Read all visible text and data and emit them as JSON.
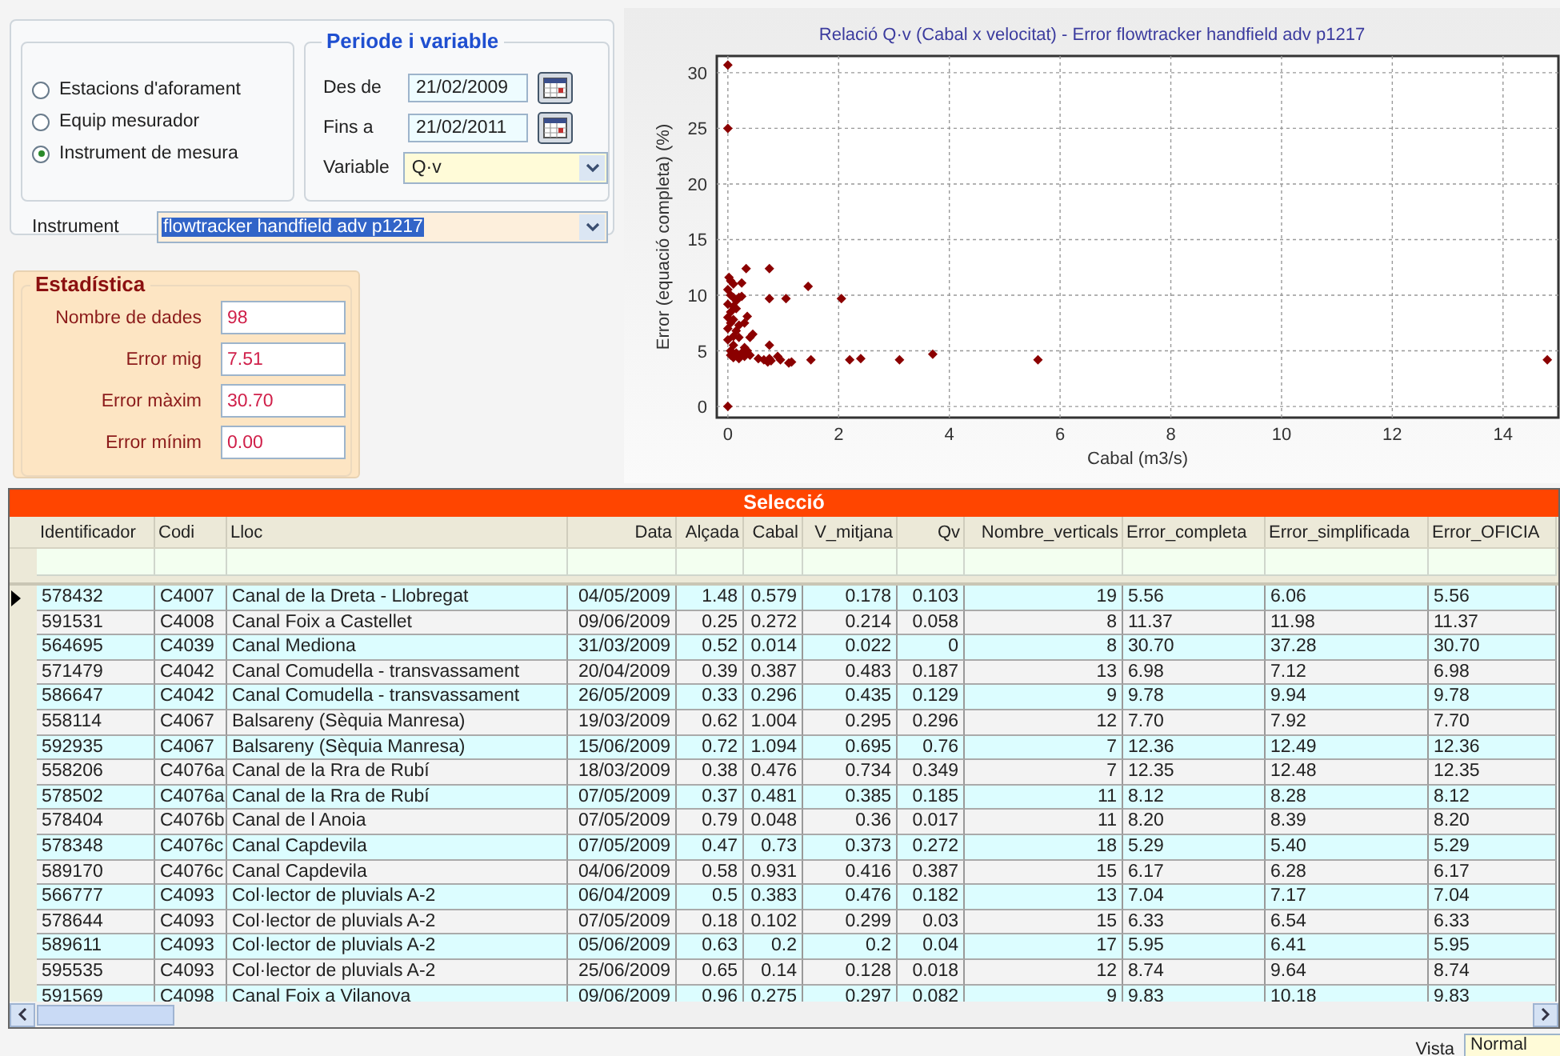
{
  "mode_options": [
    {
      "label": "Estacions d'aforament",
      "selected": false
    },
    {
      "label": "Equip mesurador",
      "selected": false
    },
    {
      "label": "Instrument de mesura",
      "selected": true
    }
  ],
  "period": {
    "title": "Periode i variable",
    "from_label": "Des de",
    "from_value": "21/02/2009",
    "to_label": "Fins a",
    "to_value": "21/02/2011",
    "variable_label": "Variable",
    "variable_value": "Q·v"
  },
  "instrument": {
    "label": "Instrument",
    "value": "flowtracker handfield adv p1217"
  },
  "statistics": {
    "title": "Estadística",
    "items": [
      {
        "label": "Nombre de dades",
        "value": "98"
      },
      {
        "label": "Error mig",
        "value": "7.51"
      },
      {
        "label": "Error màxim",
        "value": "30.70"
      },
      {
        "label": "Error mínim",
        "value": "0.00"
      }
    ]
  },
  "chart": {
    "chart_data": {
      "type": "scatter",
      "title": "Relació Q·v (Cabal x velocitat) - Error flowtracker handfield adv p1217",
      "xlabel": "Cabal (m3/s)",
      "ylabel": "Error (equació completa) (%)",
      "xlim": [
        -0.2,
        15
      ],
      "ylim": [
        -1,
        31.5
      ],
      "grid": true,
      "xticks": [
        0,
        2,
        4,
        6,
        8,
        10,
        12,
        14
      ],
      "yticks": [
        0,
        5,
        10,
        15,
        20,
        25,
        30
      ],
      "x": [
        0,
        0,
        0,
        0.02,
        0.05,
        0.1,
        0,
        0.05,
        0.1,
        0.2,
        0.25,
        0.15,
        0,
        0.1,
        0.05,
        0.15,
        0,
        0.1,
        0.35,
        0.05,
        0.2,
        0.3,
        0,
        0.15,
        0.1,
        0.2,
        0.45,
        0.4,
        0,
        0.1,
        0.3,
        0.35,
        0.05,
        0.15,
        0.25,
        0.05,
        0.1,
        0.2,
        0.3,
        0.4,
        0.55,
        0.65,
        0.72,
        0.75,
        0.78,
        0.9,
        0.95,
        1.1,
        1.15,
        1.5,
        2.2,
        2.4,
        3.1,
        3.7,
        5.6,
        14.8,
        0.75,
        0.33,
        0.75,
        1.45,
        0.75,
        1.05,
        2.05,
        0.25
      ],
      "series": [
        {
          "color": "#8b0000",
          "values": [
            30.7,
            25,
            0,
            11.6,
            11.3,
            11,
            10.5,
            10,
            9.8,
            9.8,
            9.9,
            9.5,
            9.2,
            9,
            8.5,
            8.8,
            8,
            7.8,
            8.1,
            7.5,
            7.3,
            7.5,
            7,
            6.8,
            6.3,
            6.2,
            6.5,
            6.2,
            6,
            5.5,
            5.3,
            5,
            5,
            4.8,
            4.8,
            4.6,
            4.4,
            4.3,
            4.5,
            4.6,
            4.3,
            4.2,
            4,
            4.3,
            4.1,
            4.5,
            4.2,
            3.9,
            4,
            4.2,
            4.2,
            4.3,
            4.2,
            4.7,
            4.2,
            4.2,
            5.5,
            12.4,
            12.4,
            10.8,
            9.7,
            9.7,
            9.7,
            11.1
          ]
        }
      ]
    }
  },
  "table": {
    "title": "Selecció",
    "columns": [
      "Identificador",
      "Codi",
      "Lloc",
      "Data",
      "Alçada",
      "Cabal",
      "V_mitjana",
      "Qv",
      "Nombre_verticals",
      "Error_completa",
      "Error_simplificada",
      "Error_OFICIA"
    ],
    "rows": [
      {
        "selected": true,
        "cells": [
          "578432",
          "C4007",
          "Canal de la Dreta - Llobregat",
          "04/05/2009",
          "1.48",
          "0.579",
          "0.178",
          "0.103",
          "19",
          "5.56",
          "6.06",
          "5.56"
        ]
      },
      {
        "selected": false,
        "cells": [
          "591531",
          "C4008",
          "Canal Foix a Castellet",
          "09/06/2009",
          "0.25",
          "0.272",
          "0.214",
          "0.058",
          "8",
          "11.37",
          "11.98",
          "11.37"
        ]
      },
      {
        "selected": false,
        "cells": [
          "564695",
          "C4039",
          "Canal Mediona",
          "31/03/2009",
          "0.52",
          "0.014",
          "0.022",
          "0",
          "8",
          "30.70",
          "37.28",
          "30.70"
        ]
      },
      {
        "selected": false,
        "cells": [
          "571479",
          "C4042",
          "Canal Comudella - transvassament",
          "20/04/2009",
          "0.39",
          "0.387",
          "0.483",
          "0.187",
          "13",
          "6.98",
          "7.12",
          "6.98"
        ]
      },
      {
        "selected": false,
        "cells": [
          "586647",
          "C4042",
          "Canal Comudella - transvassament",
          "26/05/2009",
          "0.33",
          "0.296",
          "0.435",
          "0.129",
          "9",
          "9.78",
          "9.94",
          "9.78"
        ]
      },
      {
        "selected": false,
        "cells": [
          "558114",
          "C4067",
          "Balsareny (Sèquia Manresa)",
          "19/03/2009",
          "0.62",
          "1.004",
          "0.295",
          "0.296",
          "12",
          "7.70",
          "7.92",
          "7.70"
        ]
      },
      {
        "selected": false,
        "cells": [
          "592935",
          "C4067",
          "Balsareny (Sèquia Manresa)",
          "15/06/2009",
          "0.72",
          "1.094",
          "0.695",
          "0.76",
          "7",
          "12.36",
          "12.49",
          "12.36"
        ]
      },
      {
        "selected": false,
        "cells": [
          "558206",
          "C4076a",
          "Canal de la Rra de Rubí",
          "18/03/2009",
          "0.38",
          "0.476",
          "0.734",
          "0.349",
          "7",
          "12.35",
          "12.48",
          "12.35"
        ]
      },
      {
        "selected": false,
        "cells": [
          "578502",
          "C4076a",
          "Canal de la Rra de Rubí",
          "07/05/2009",
          "0.37",
          "0.481",
          "0.385",
          "0.185",
          "11",
          "8.12",
          "8.28",
          "8.12"
        ]
      },
      {
        "selected": false,
        "cells": [
          "578404",
          "C4076b",
          "Canal de l Anoia",
          "07/05/2009",
          "0.79",
          "0.048",
          "0.36",
          "0.017",
          "11",
          "8.20",
          "8.39",
          "8.20"
        ]
      },
      {
        "selected": false,
        "cells": [
          "578348",
          "C4076c",
          "Canal Capdevila",
          "07/05/2009",
          "0.47",
          "0.73",
          "0.373",
          "0.272",
          "18",
          "5.29",
          "5.40",
          "5.29"
        ]
      },
      {
        "selected": false,
        "cells": [
          "589170",
          "C4076c",
          "Canal Capdevila",
          "04/06/2009",
          "0.58",
          "0.931",
          "0.416",
          "0.387",
          "15",
          "6.17",
          "6.28",
          "6.17"
        ]
      },
      {
        "selected": false,
        "cells": [
          "566777",
          "C4093",
          "Col·lector de pluvials A-2",
          "06/04/2009",
          "0.5",
          "0.383",
          "0.476",
          "0.182",
          "13",
          "7.04",
          "7.17",
          "7.04"
        ]
      },
      {
        "selected": false,
        "cells": [
          "578644",
          "C4093",
          "Col·lector de pluvials A-2",
          "07/05/2009",
          "0.18",
          "0.102",
          "0.299",
          "0.03",
          "15",
          "6.33",
          "6.54",
          "6.33"
        ]
      },
      {
        "selected": false,
        "cells": [
          "589611",
          "C4093",
          "Col·lector de pluvials A-2",
          "05/06/2009",
          "0.63",
          "0.2",
          "0.2",
          "0.04",
          "17",
          "5.95",
          "6.41",
          "5.95"
        ]
      },
      {
        "selected": false,
        "cells": [
          "595535",
          "C4093",
          "Col·lector de pluvials A-2",
          "25/06/2009",
          "0.65",
          "0.14",
          "0.128",
          "0.018",
          "12",
          "8.74",
          "9.64",
          "8.74"
        ]
      },
      {
        "selected": false,
        "cells": [
          "591569",
          "C4098",
          "Canal Foix a Vilanova",
          "09/06/2009",
          "0.96",
          "0.275",
          "0.297",
          "0.082",
          "9",
          "9.83",
          "10.18",
          "9.83"
        ]
      }
    ]
  },
  "status_bar": {
    "view_label": "Vista",
    "view_value": "Normal"
  }
}
